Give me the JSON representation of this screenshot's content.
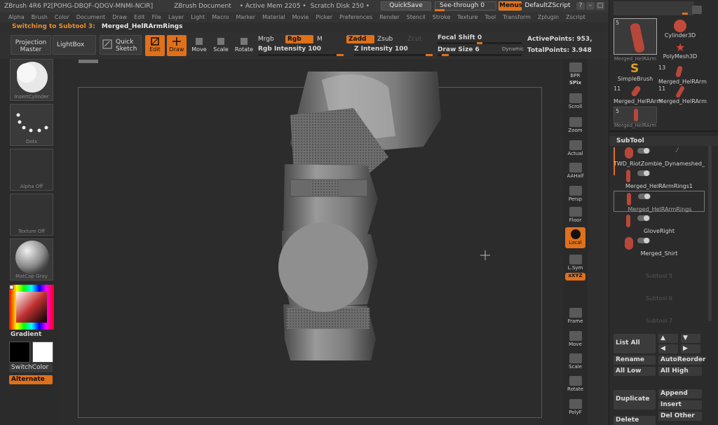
{
  "titlebar": {
    "app": "ZBrush 4R6 P2[POHG-DBQF-QDGV-MNMI-NCIR]",
    "document": "ZBrush Document",
    "active_mem": "• Active Mem 2205 •",
    "scratch": "Scratch Disk 250 •",
    "quicksave": "QuickSave",
    "see_through": "See-through 0",
    "menus": "Menus",
    "script": "DefaultZScript",
    "win_buttons": [
      "?",
      "–",
      "□",
      "×"
    ]
  },
  "menubar": [
    "Alpha",
    "Brush",
    "Color",
    "Document",
    "Draw",
    "Edit",
    "File",
    "Layer",
    "Light",
    "Macro",
    "Marker",
    "Material",
    "Movie",
    "Picker",
    "Preferences",
    "Render",
    "Stencil",
    "Stroke",
    "Texture",
    "Tool",
    "Transform",
    "Zplugin",
    "Zscript"
  ],
  "switch_line": {
    "label": "Switching to Subtool 3:",
    "value": "Merged_HelRArmRings"
  },
  "shelf": {
    "projection_master": "Projection Master",
    "lightbox": "LightBox",
    "quick_sketch": "Quick Sketch",
    "tools": [
      {
        "label": "Edit"
      },
      {
        "label": "Draw"
      },
      {
        "label": "Move"
      },
      {
        "label": "Scale"
      },
      {
        "label": "Rotate"
      }
    ],
    "mrgb": "Mrgb",
    "rgb": "Rgb",
    "m": "M",
    "zadd": "Zadd",
    "zsub": "Zsub",
    "zcut": "Zcut",
    "rgb_intensity": "Rgb Intensity 100",
    "z_intensity": "Z Intensity 100",
    "focal_shift": "Focal Shift 0",
    "draw_size": "Draw Size 6",
    "dynamic": "Dynamic",
    "active_points": "ActivePoints: 953,",
    "total_points": "TotalPoints: 3.948"
  },
  "left_panel": {
    "thumbs": [
      "InsertCylinder",
      "Dots",
      "Alpha Off",
      "Texture Off",
      "MatCap Gray"
    ],
    "gradient": "Gradient",
    "switch_color": "SwitchColor",
    "alternate": "Alternate"
  },
  "right_toolbar": [
    "BPR",
    "SPix",
    "Scroll",
    "Zoom",
    "Actual",
    "AAHalf",
    "Persp",
    "Floor",
    "Local",
    "L.Sym",
    "xXYZ",
    "Frame",
    "Move",
    "Scale",
    "Rotate",
    "PolyF"
  ],
  "tool_palette": {
    "tiles": [
      {
        "label": "Merged_HelRArm",
        "count": "5"
      },
      {
        "label": "Cylinder3D",
        "count": ""
      },
      {
        "label": "PolyMesh3D",
        "count": ""
      },
      {
        "label": "SimpleBrush",
        "count": "13"
      },
      {
        "label": "Merged_HelRArm",
        "count": ""
      },
      {
        "label": "Merged_HelRArm",
        "count": "11"
      },
      {
        "label": "Merged_HelRArm",
        "count": "11"
      },
      {
        "label": "Merged_HelRArm",
        "count": "5"
      }
    ]
  },
  "subtool": {
    "title": "SubTool",
    "items": [
      {
        "name": "TWD_RiotZombie_Dynameshed_"
      },
      {
        "name": "Merged_HelRArmRings1"
      },
      {
        "name": "Merged_HelRArmRings"
      },
      {
        "name": "GloveRight"
      },
      {
        "name": "Merged_Shirt"
      },
      {
        "name": "Subtool 5"
      },
      {
        "name": "Subtool 6"
      },
      {
        "name": "Subtool 7"
      }
    ],
    "list_all": "List All",
    "rename": "Rename",
    "auto_reorder": "AutoReorder",
    "all_low": "All Low",
    "all_high": "All High",
    "duplicate": "Duplicate",
    "append": "Append",
    "insert": "Insert",
    "delete": "Delete",
    "del_other": "Del Other"
  },
  "colors": {
    "accent": "#e0701a",
    "panel": "#2b2b2b",
    "canvas": "#2c2c2c",
    "model": "#8a8a8a"
  }
}
